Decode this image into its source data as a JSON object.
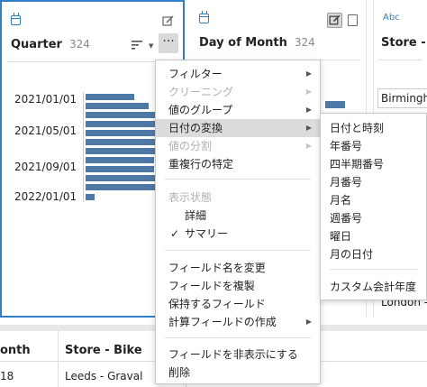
{
  "quarter_card": {
    "title": "Quarter",
    "count": "324",
    "more_label": "···",
    "tick_labels": [
      "2021/01/01",
      "2021/05/01",
      "2021/09/01",
      "2022/01/01"
    ]
  },
  "day_card": {
    "title": "Day of Month",
    "count": "324"
  },
  "store_card": {
    "type_label": "Abc",
    "title": "Store - Bi",
    "values": [
      "Birmingh",
      "London - "
    ]
  },
  "bottom_grid": {
    "headers": [
      "onth",
      "Store - Bike"
    ],
    "row": [
      "18",
      "Leeds - Graval"
    ]
  },
  "context_menu": {
    "items": [
      {
        "label": "フィルター",
        "arrow": "▶"
      },
      {
        "label": "クリーニング",
        "arrow": "▶"
      },
      {
        "label": "値のグループ",
        "arrow": "▶"
      },
      {
        "label": "日付の変換",
        "arrow": "▶"
      },
      {
        "label": "値の分割",
        "arrow": "▶"
      },
      {
        "label": "重複行の特定"
      },
      {
        "label": "表示状態"
      },
      {
        "label": "詳細"
      },
      {
        "label": "サマリー",
        "check": "✓"
      },
      {
        "label": "フィールド名を変更"
      },
      {
        "label": "フィールドを複製"
      },
      {
        "label": "保持するフィールド"
      },
      {
        "label": "計算フィールドの作成",
        "arrow": "▶"
      },
      {
        "label": "フィールドを非表示にする"
      },
      {
        "label": "削除"
      }
    ]
  },
  "date_submenu": {
    "items": [
      {
        "label": "日付と時刻"
      },
      {
        "label": "年番号"
      },
      {
        "label": "四半期番号"
      },
      {
        "label": "月番号"
      },
      {
        "label": "月名"
      },
      {
        "label": "週番号"
      },
      {
        "label": "曜日"
      },
      {
        "label": "月の日付"
      },
      {
        "label": "カスタム会計年度"
      }
    ]
  },
  "colors": {
    "accent": "#2f80c8",
    "bar": "#4e79a7",
    "highlight": "#dcdcdc"
  }
}
